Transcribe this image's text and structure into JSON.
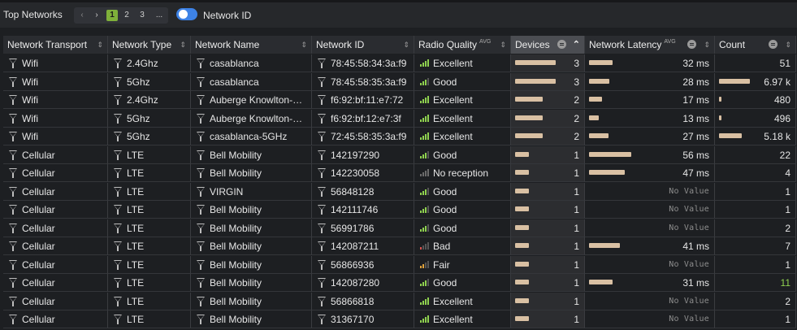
{
  "panel": {
    "title": "Top Networks",
    "pager": {
      "prev": "‹",
      "next": "›",
      "pages": [
        "1",
        "2",
        "3"
      ],
      "more": "...",
      "current": "1"
    },
    "toggle_label": "Network ID",
    "toggle_on": true
  },
  "columns": [
    {
      "key": "transport",
      "label": "Network Transport"
    },
    {
      "key": "type",
      "label": "Network Type"
    },
    {
      "key": "name",
      "label": "Network Name"
    },
    {
      "key": "id",
      "label": "Network ID"
    },
    {
      "key": "quality",
      "label": "Radio Quality",
      "badge": "AVG"
    },
    {
      "key": "devices",
      "label": "Devices"
    },
    {
      "key": "latency",
      "label": "Network Latency",
      "badge": "AVG"
    },
    {
      "key": "count",
      "label": "Count"
    }
  ],
  "colors": {
    "bar": "#d9c0a3",
    "excellent": "#8fd14f",
    "good": "#8fd14f",
    "fair": "#e0a23b",
    "bad": "#d9534f",
    "none": "#6b6b6b",
    "active_header": "#4b4d52"
  },
  "rows": [
    {
      "transport": "Wifi",
      "type": "2.4Ghz",
      "name": "casablanca",
      "id": "78:45:58:34:3a:f9",
      "quality": "Excellent",
      "quality_level": 4,
      "quality_color": "#8fd14f",
      "devices": "3",
      "devices_frac": 1.0,
      "latency": "32 ms",
      "latency_frac": 0.55,
      "count": "51",
      "count_frac": 0.0
    },
    {
      "transport": "Wifi",
      "type": "5Ghz",
      "name": "casablanca",
      "id": "78:45:58:35:3a:f9",
      "quality": "Good",
      "quality_level": 3,
      "quality_color": "#8fd14f",
      "devices": "3",
      "devices_frac": 1.0,
      "latency": "28 ms",
      "latency_frac": 0.48,
      "count": "6.97 k",
      "count_frac": 1.0
    },
    {
      "transport": "Wifi",
      "type": "2.4Ghz",
      "name": "Auberge Knowlton-…",
      "id": "f6:92:bf:11:e7:72",
      "quality": "Excellent",
      "quality_level": 4,
      "quality_color": "#8fd14f",
      "devices": "2",
      "devices_frac": 0.68,
      "latency": "17 ms",
      "latency_frac": 0.3,
      "count": "480",
      "count_frac": 0.07
    },
    {
      "transport": "Wifi",
      "type": "5Ghz",
      "name": "Auberge Knowlton-…",
      "id": "f6:92:bf:12:e7:3f",
      "quality": "Excellent",
      "quality_level": 4,
      "quality_color": "#8fd14f",
      "devices": "2",
      "devices_frac": 0.68,
      "latency": "13 ms",
      "latency_frac": 0.24,
      "count": "496",
      "count_frac": 0.07
    },
    {
      "transport": "Wifi",
      "type": "5Ghz",
      "name": "casablanca-5GHz",
      "id": "72:45:58:35:3a:f9",
      "quality": "Excellent",
      "quality_level": 4,
      "quality_color": "#8fd14f",
      "devices": "2",
      "devices_frac": 0.68,
      "latency": "27 ms",
      "latency_frac": 0.47,
      "count": "5.18 k",
      "count_frac": 0.74
    },
    {
      "transport": "Cellular",
      "type": "LTE",
      "name": "Bell Mobility",
      "id": "142197290",
      "quality": "Good",
      "quality_level": 3,
      "quality_color": "#8fd14f",
      "devices": "1",
      "devices_frac": 0.34,
      "latency": "56 ms",
      "latency_frac": 1.0,
      "count": "22",
      "count_frac": 0.0
    },
    {
      "transport": "Cellular",
      "type": "LTE",
      "name": "Bell Mobility",
      "id": "142230058",
      "quality": "No reception",
      "quality_level": 0,
      "quality_color": "#6b6b6b",
      "devices": "1",
      "devices_frac": 0.34,
      "latency": "47 ms",
      "latency_frac": 0.84,
      "count": "4",
      "count_frac": 0.0
    },
    {
      "transport": "Cellular",
      "type": "LTE",
      "name": "VIRGIN",
      "id": "56848128",
      "quality": "Good",
      "quality_level": 3,
      "quality_color": "#8fd14f",
      "devices": "1",
      "devices_frac": 0.34,
      "latency": "No Value",
      "latency_frac": 0,
      "count": "1",
      "count_frac": 0.0
    },
    {
      "transport": "Cellular",
      "type": "LTE",
      "name": "Bell Mobility",
      "id": "142111746",
      "quality": "Good",
      "quality_level": 3,
      "quality_color": "#8fd14f",
      "devices": "1",
      "devices_frac": 0.34,
      "latency": "No Value",
      "latency_frac": 0,
      "count": "1",
      "count_frac": 0.0
    },
    {
      "transport": "Cellular",
      "type": "LTE",
      "name": "Bell Mobility",
      "id": "56991786",
      "quality": "Good",
      "quality_level": 3,
      "quality_color": "#8fd14f",
      "devices": "1",
      "devices_frac": 0.34,
      "latency": "No Value",
      "latency_frac": 0,
      "count": "2",
      "count_frac": 0.0
    },
    {
      "transport": "Cellular",
      "type": "LTE",
      "name": "Bell Mobility",
      "id": "142087211",
      "quality": "Bad",
      "quality_level": 1,
      "quality_color": "#d9534f",
      "devices": "1",
      "devices_frac": 0.34,
      "latency": "41 ms",
      "latency_frac": 0.73,
      "count": "7",
      "count_frac": 0.0
    },
    {
      "transport": "Cellular",
      "type": "LTE",
      "name": "Bell Mobility",
      "id": "56866936",
      "quality": "Fair",
      "quality_level": 2,
      "quality_color": "#e0a23b",
      "devices": "1",
      "devices_frac": 0.34,
      "latency": "No Value",
      "latency_frac": 0,
      "count": "1",
      "count_frac": 0.0
    },
    {
      "transport": "Cellular",
      "type": "LTE",
      "name": "Bell Mobility",
      "id": "142087280",
      "quality": "Good",
      "quality_level": 3,
      "quality_color": "#8fd14f",
      "devices": "1",
      "devices_frac": 0.34,
      "latency": "31 ms",
      "latency_frac": 0.55,
      "count": "11",
      "count_frac": 0.0,
      "count_color": "#8fd14f"
    },
    {
      "transport": "Cellular",
      "type": "LTE",
      "name": "Bell Mobility",
      "id": "56866818",
      "quality": "Excellent",
      "quality_level": 4,
      "quality_color": "#8fd14f",
      "devices": "1",
      "devices_frac": 0.34,
      "latency": "No Value",
      "latency_frac": 0,
      "count": "2",
      "count_frac": 0.0
    },
    {
      "transport": "Cellular",
      "type": "LTE",
      "name": "Bell Mobility",
      "id": "31367170",
      "quality": "Excellent",
      "quality_level": 4,
      "quality_color": "#8fd14f",
      "devices": "1",
      "devices_frac": 0.34,
      "latency": "No Value",
      "latency_frac": 0,
      "count": "1",
      "count_frac": 0.0
    }
  ]
}
